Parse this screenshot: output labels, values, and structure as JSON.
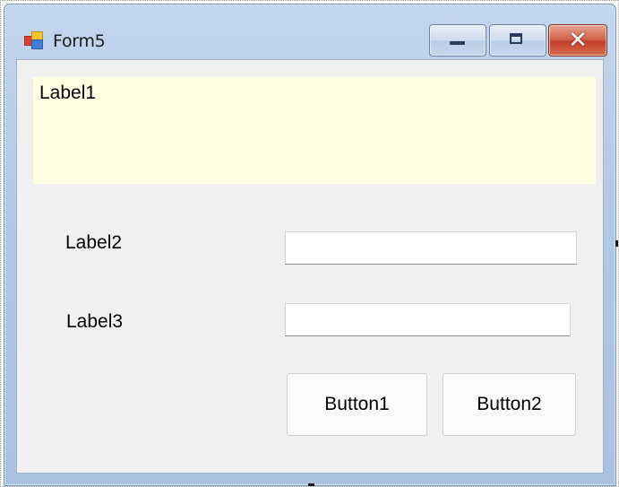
{
  "window": {
    "title": "Form5",
    "app_icon": "windows-forms-icon",
    "caption_buttons": {
      "minimize": "minimize-icon",
      "maximize": "maximize-icon",
      "close": "close-icon"
    },
    "close_glyph": "✕"
  },
  "form": {
    "label1": "Label1",
    "label2": "Label2",
    "label3": "Label3",
    "textbox1_value": "",
    "textbox2_value": "",
    "button1": "Button1",
    "button2": "Button2"
  },
  "colors": {
    "client_background": "#f0f0f0",
    "label1_background": "#ffffe1",
    "title_bar": "#b9cfe9",
    "close_button": "#c94a32"
  }
}
